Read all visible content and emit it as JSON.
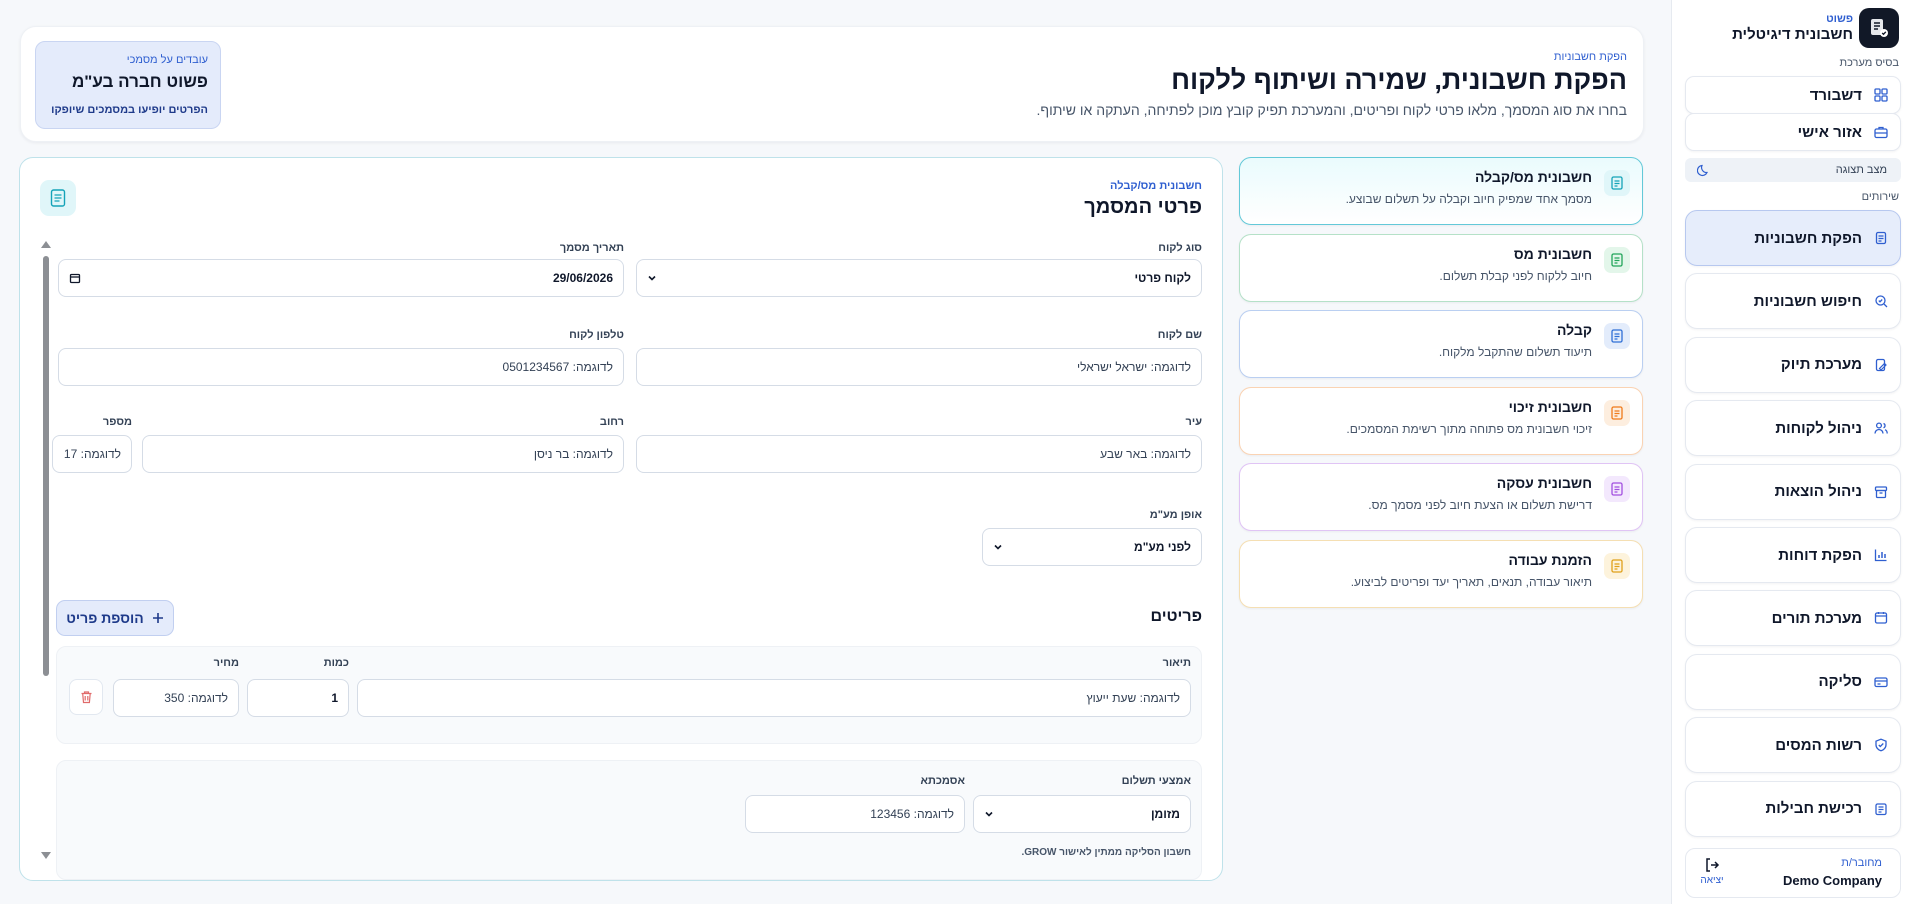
{
  "sidebar": {
    "brand_sub": "פשוט",
    "brand_title": "חשבונית דיגיטלית",
    "section_system": "בסיס מערכת",
    "dashboard": "דשבורד",
    "personal": "אזור אישי",
    "display_mode": "מצב תצוגה",
    "section_services": "שירותים",
    "items": [
      {
        "label": "הפקת חשבוניות",
        "icon": "document-icon"
      },
      {
        "label": "חיפוש חשבוניות",
        "icon": "search-doc-icon"
      },
      {
        "label": "מערכת תיוק",
        "icon": "filing-icon"
      },
      {
        "label": "ניהול לקוחות",
        "icon": "users-icon"
      },
      {
        "label": "ניהול הוצאות",
        "icon": "archive-icon"
      },
      {
        "label": "הפקת דוחות",
        "icon": "chart-icon"
      },
      {
        "label": "מערכת תורים",
        "icon": "queue-icon"
      },
      {
        "label": "סליקה",
        "icon": "credit-card-icon"
      },
      {
        "label": "רשות המסים",
        "icon": "shield-icon"
      },
      {
        "label": "רכישת חבילות",
        "icon": "package-icon"
      }
    ],
    "user_label": "מחובר/ת",
    "user_name": "Demo Company",
    "logout": "יציאה"
  },
  "header": {
    "eyebrow": "הפקת חשבוניות",
    "title": "הפקת חשבונית, שמירה ושיתוף ללקוח",
    "description": "בחרו את סוג המסמך, מלאו פרטי לקוח ופריטים, והמערכת תפיק קובץ מוכן לפתיחה, העתקה או שיתוף.",
    "tag_eyebrow": "עובדים על מסמכי",
    "tag_company": "פשוט חברה בע\"מ",
    "tag_note": "הפרטים יופיעו במסמכים שיופקו"
  },
  "doc_types": [
    {
      "title": "חשבונית מס/קבלה",
      "desc": "מסמך אחד שמפיק חיוב וקבלה על תשלום שבוצע.",
      "color": "#14a3b8",
      "bg": "#e0f6f9"
    },
    {
      "title": "חשבונית מס",
      "desc": "חיוב ללקוח לפני קבלת תשלום.",
      "color": "#22a55a",
      "bg": "#e3f6ea"
    },
    {
      "title": "קבלה",
      "desc": "תיעוד תשלום שהתקבל מלקוח.",
      "color": "#2f6fd6",
      "bg": "#e3ecfb"
    },
    {
      "title": "חשבונית זיכוי",
      "desc": "זיכוי חשבונית מס פתוחה מתוך רשימת המסמכים.",
      "color": "#f07a1a",
      "bg": "#fdeedf"
    },
    {
      "title": "חשבונית עסקה",
      "desc": "דרישת תשלום או הצעת חיוב לפני מסמך מס.",
      "color": "#a24fe0",
      "bg": "#f3e8fd"
    },
    {
      "title": "הזמנת עבודה",
      "desc": "תיאור עבודה, תנאים, תאריך יעד ופריטים לביצוע.",
      "color": "#e0a01a",
      "bg": "#fdf3dc"
    }
  ],
  "form": {
    "eyebrow": "חשבונית מס/קבלה",
    "title": "פרטי המסמך",
    "customer_type_label": "סוג לקוח",
    "customer_type_value": "לקוח פרטי",
    "doc_date_label": "תאריך מסמך",
    "doc_date_value": "29/06/2026",
    "customer_name_label": "שם לקוח",
    "customer_name_placeholder": "לדוגמה: ישראל ישראלי",
    "customer_phone_label": "טלפון לקוח",
    "customer_phone_placeholder": "לדוגמה: 0501234567",
    "city_label": "עיר",
    "city_placeholder": "לדוגמה: באר שבע",
    "street_label": "רחוב",
    "street_placeholder": "לדוגמה: בר ניסן",
    "number_label": "מספר",
    "number_placeholder": "לדוגמה: 17",
    "vat_label": "אופן מע\"מ",
    "vat_value": "לפני מע\"מ",
    "items_title": "פריטים",
    "add_item": "הוספת פריט",
    "item_desc_label": "תיאור",
    "item_desc_placeholder": "לדוגמה: שעת ייעוץ",
    "item_qty_label": "כמות",
    "item_qty_value": "1",
    "item_price_label": "מחיר",
    "item_price_placeholder": "לדוגמה: 350",
    "payment_label": "אמצעי תשלום",
    "payment_value": "מזומן",
    "reference_label": "אסמכתא",
    "reference_placeholder": "לדוגמה: 123456",
    "notice": "חשבון הסליקה ממתין לאישור GROW."
  }
}
